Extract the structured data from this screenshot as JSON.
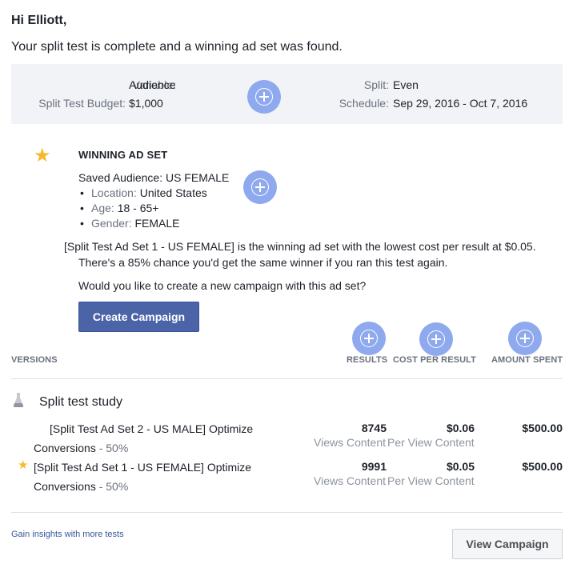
{
  "greeting": "Hi Elliott,",
  "intro": "Your split test is complete and a winning ad set was found.",
  "summary": {
    "variable_label": "Variable:",
    "variable_value": "Audience",
    "budget_label": "Split Test Budget:",
    "budget_value": "$1,000",
    "split_label": "Split:",
    "split_value": "Even",
    "schedule_label": "Schedule:",
    "schedule_value": "Sep 29, 2016 - Oct 7, 2016"
  },
  "winner": {
    "title": "WINNING AD SET",
    "audience": "Saved Audience: US FEMALE",
    "location_label": "Location:",
    "location_value": "United States",
    "age_label": "Age:",
    "age_value": "18 - 65+",
    "gender_label": "Gender:",
    "gender_value": "FEMALE",
    "result_line1": "[Split Test Ad Set 1 - US FEMALE]  is the winning ad set with the lowest cost per result at $0.05.",
    "result_line2": "There's a 85% chance you'd get the same winner if you ran this test again.",
    "question": "Would you like to create a new campaign with this ad set?",
    "create_label": "Create Campaign"
  },
  "table": {
    "headers": {
      "versions": "VERSIONS",
      "results": "RESULTS",
      "cost": "COST PER RESULT",
      "spent": "AMOUNT SPENT"
    },
    "study_title": "Split test study",
    "rows": [
      {
        "name_line1": "[Split Test Ad Set 2 - US MALE] Optimize",
        "name_line2": "Conversions",
        "split": "- 50%",
        "results": "8745",
        "results_sub": "Views Content",
        "cost": "$0.06",
        "cost_sub": "Per View Content",
        "spent": "$500.00"
      },
      {
        "name_line1": "[Split Test Ad Set 1 - US FEMALE] Optimize",
        "name_line2": "Conversions",
        "split": "- 50%",
        "results": "9991",
        "results_sub": "Views Content",
        "cost": "$0.05",
        "cost_sub": "Per View Content",
        "spent": "$500.00"
      }
    ]
  },
  "footer": {
    "link": "Gain insights with more tests",
    "view_label": "View Campaign"
  },
  "icons": [
    "plus-circle-icon",
    "star-icon",
    "flask-icon"
  ],
  "colors": {
    "accent_button": "#4b64a8",
    "star": "#f7b928",
    "plus_circle": "#8fa9ee",
    "summary_bg": "#f2f3f6",
    "link": "#365899"
  }
}
